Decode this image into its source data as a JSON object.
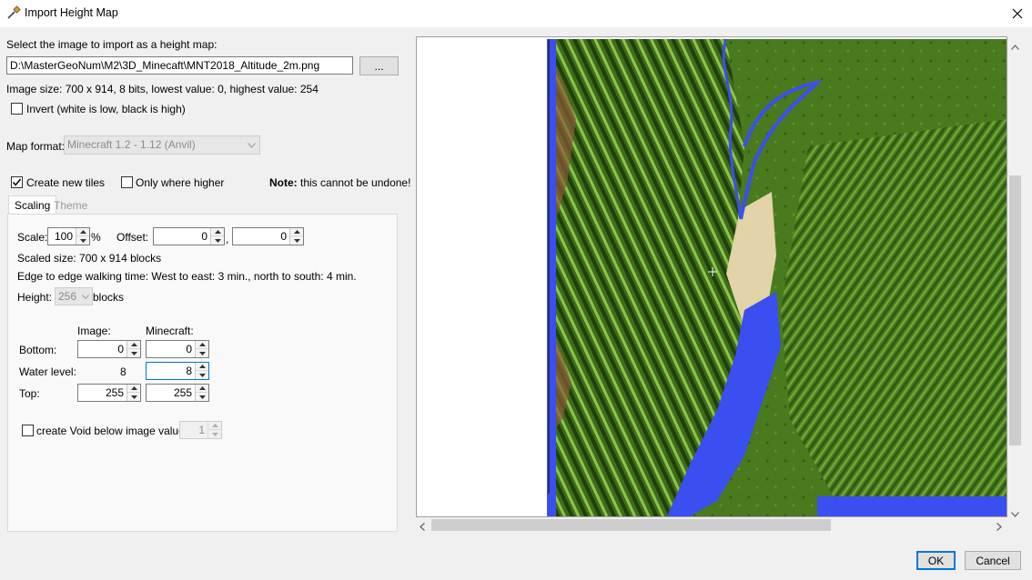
{
  "window": {
    "title": "Import Height Map",
    "icon": "dropper-icon",
    "close": "✕"
  },
  "file": {
    "prompt": "Select the image to import as a height map:",
    "path": "D:\\MasterGeoNum\\M2\\3D_Minecaft\\MNT2018_Altitude_2m.png",
    "browse_label": "...",
    "image_info": "Image size: 700 x 914, 8 bits, lowest value: 0, highest value: 254"
  },
  "invert": {
    "label": "Invert (white is low, black is high)",
    "checked": false
  },
  "map_format": {
    "label": "Map format:",
    "value": "Minecraft 1.2 - 1.12 (Anvil)"
  },
  "tiles": {
    "create_new_label": "Create new tiles",
    "create_new_checked": true,
    "only_higher_label": "Only where higher",
    "only_higher_checked": false,
    "note_bold": "Note:",
    "note_text": " this cannot be undone!"
  },
  "tabs": [
    {
      "label": "Scaling",
      "active": true
    },
    {
      "label": "Theme",
      "active": false
    }
  ],
  "scaling": {
    "scale_label": "Scale:",
    "scale_value": "100",
    "percent": "%",
    "offset_label": "Offset:",
    "offset_x": "0",
    "offset_sep": ",",
    "offset_y": "0",
    "scaled_size": "Scaled size: 700 x 914 blocks",
    "walking_time": "Edge to edge walking time:  West to east: 3 min., north to south: 4 min.",
    "height_label": "Height:",
    "height_value": "256",
    "height_unit": "blocks",
    "col_image": "Image:",
    "col_minecraft": "Minecraft:",
    "rows": [
      {
        "label": "Bottom:",
        "image": "0",
        "minecraft": "0"
      },
      {
        "label": "Water level:",
        "image": "8",
        "minecraft": "8"
      },
      {
        "label": "Top:",
        "image": "255",
        "minecraft": "255"
      }
    ],
    "void_label": "create Void below image value:",
    "void_checked": false,
    "void_value": "1"
  },
  "buttons": {
    "ok": "OK",
    "cancel": "Cancel"
  },
  "colors": {
    "terrain_green": "#4a7a1e",
    "water_blue": "#3a4ff0",
    "sand": "#e2d3a8",
    "accent": "#0078d7"
  }
}
